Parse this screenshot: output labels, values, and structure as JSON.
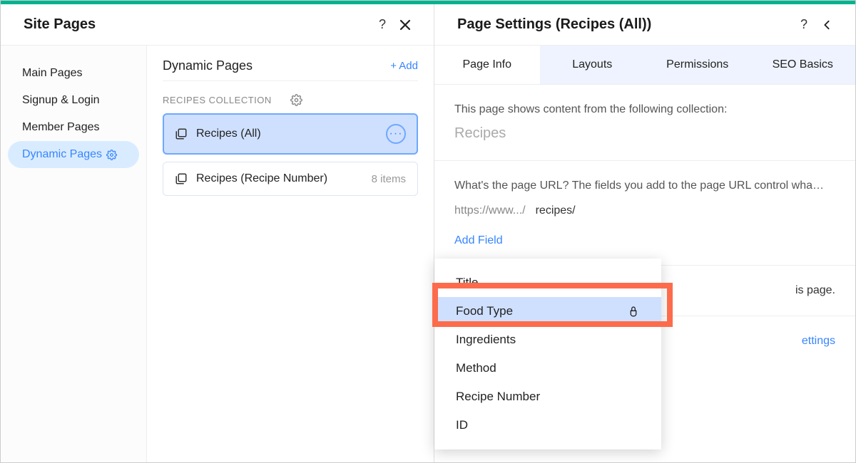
{
  "leftPanel": {
    "title": "Site Pages",
    "nav": [
      {
        "label": "Main Pages"
      },
      {
        "label": "Signup & Login"
      },
      {
        "label": "Member Pages"
      },
      {
        "label": "Dynamic Pages"
      }
    ],
    "content": {
      "heading": "Dynamic Pages",
      "addLabel": "+  Add",
      "collectionLabel": "RECIPES COLLECTION",
      "items": [
        {
          "label": "Recipes (All)",
          "meta": ""
        },
        {
          "label": "Recipes (Recipe Number)",
          "meta": "8 items"
        }
      ]
    }
  },
  "rightPanel": {
    "title": "Page Settings (Recipes (All))",
    "tabs": [
      "Page Info",
      "Layouts",
      "Permissions",
      "SEO Basics"
    ],
    "section1": {
      "lead": "This page shows content from the following collection:",
      "collection": "Recipes"
    },
    "section2": {
      "lead": "What's the page URL? The fields you add to the page URL control wha…",
      "urlBase": "https://www.../",
      "urlPath": "recipes/",
      "addField": "Add Field"
    },
    "section3": {
      "trail": "is page."
    },
    "section4": {
      "trail": "ettings"
    },
    "dropdown": [
      "Title",
      "Food Type",
      "Ingredients",
      "Method",
      "Recipe Number",
      "ID"
    ]
  }
}
